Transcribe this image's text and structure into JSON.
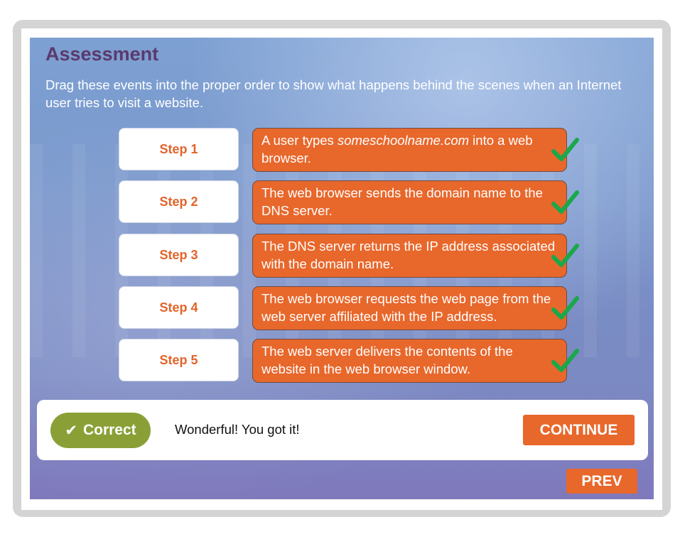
{
  "assessment": {
    "title": "Assessment",
    "instructions": "Drag these events into the proper order to show what happens behind the scenes when an Internet user tries to visit a website."
  },
  "steps": [
    {
      "label": "Step 1",
      "event_pre": "A user types ",
      "event_italic": "someschoolname.com",
      "event_post": " into a web browser.",
      "check_icon": "check-icon"
    },
    {
      "label": "Step 2",
      "event_pre": "The web browser sends the domain name to the DNS server.",
      "event_italic": "",
      "event_post": "",
      "check_icon": "check-icon"
    },
    {
      "label": "Step 3",
      "event_pre": "The DNS server returns the IP address associated with the domain name.",
      "event_italic": "",
      "event_post": "",
      "check_icon": "check-icon"
    },
    {
      "label": "Step 4",
      "event_pre": "The web browser requests the web page from the web server affiliated with the IP address.",
      "event_italic": "",
      "event_post": "",
      "check_icon": "check-icon"
    },
    {
      "label": "Step 5",
      "event_pre": "The web server delivers the contents of the website in the web browser window.",
      "event_italic": "",
      "event_post": "",
      "check_icon": "check-icon"
    }
  ],
  "feedback": {
    "badge_icon": "✔",
    "badge_label": "Correct",
    "message": "Wonderful! You got it!",
    "continue_label": "CONTINUE"
  },
  "navigation": {
    "prev_label": "PREV"
  },
  "colors": {
    "accent": "#e8672b",
    "title": "#5a3a6e",
    "correct": "#8aa037",
    "check": "#1aa84a"
  }
}
